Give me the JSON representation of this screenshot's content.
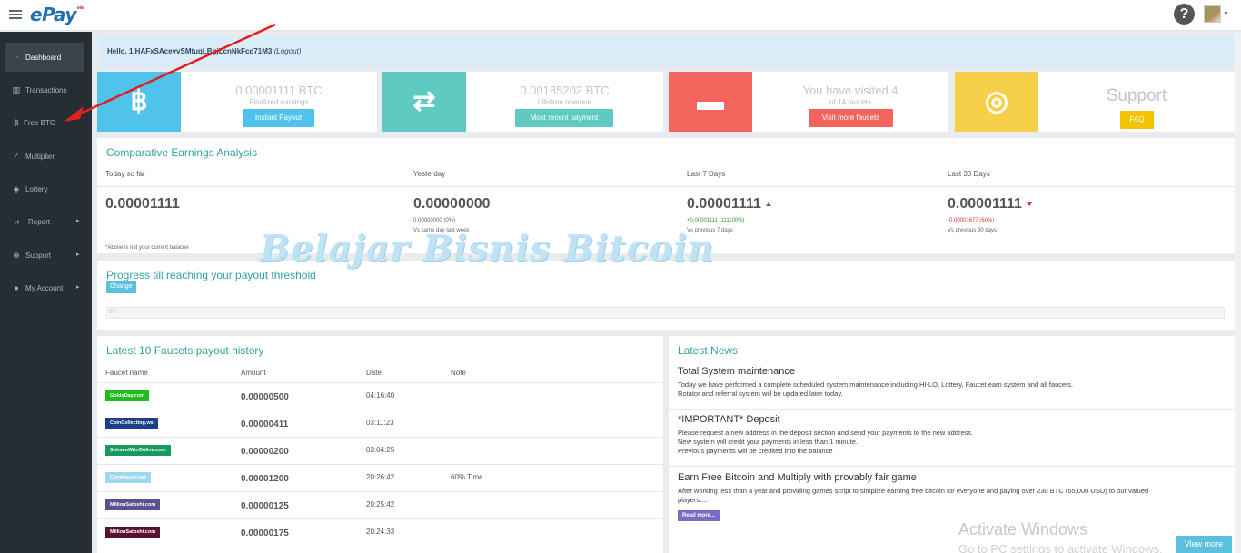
{
  "app": {
    "logo": "ePay",
    "logo_sup": "info"
  },
  "header": {
    "help_glyph": "?"
  },
  "sidebar": {
    "items": [
      {
        "label": "Dashboard",
        "icon": "dashboard-icon"
      },
      {
        "label": "Transactions",
        "icon": "bar-chart-icon"
      },
      {
        "label": "Free BTC",
        "icon": "bitcoin-icon"
      },
      {
        "label": "Multiplier",
        "icon": "magic-wand-icon"
      },
      {
        "label": "Lottery",
        "icon": "ticket-icon"
      },
      {
        "label": "Report",
        "icon": "line-chart-icon"
      },
      {
        "label": "Support",
        "icon": "lifebuoy-icon"
      },
      {
        "label": "My Account",
        "icon": "user-icon"
      }
    ]
  },
  "greeting": {
    "hello": "Hello, 1iHAFxSAcevvSMtuqLBgjLcnNkFcd71M3",
    "logout": "(Logout)"
  },
  "cards": {
    "btc": {
      "value": "0.00001111 BTC",
      "caption": "Finalized earnings",
      "button": "Instant Payout",
      "color": "#4fc3ec"
    },
    "lifetime": {
      "value": "0.00185202 BTC",
      "caption": "Lifetime revenue",
      "button": "Most recent payment",
      "color": "#5fcac2"
    },
    "visited": {
      "value": "You have visited 4",
      "caption": "of 14 faucets",
      "button": "Visit more faucets",
      "color": "#f3645c"
    },
    "support": {
      "value": "Support",
      "button": "FAQ",
      "color": "#f7d04a"
    }
  },
  "earnings": {
    "title": "Comparative Earnings Analysis",
    "columns": [
      {
        "head": "Today so far",
        "value": "0.00001111",
        "sub1": "",
        "sub2": "",
        "note": "*Above is not your current balacne"
      },
      {
        "head": "Yesterday",
        "value": "0.00000000",
        "sub1": "0.00000000 (0%)",
        "sub2": "Vs same day last week",
        "note": ""
      },
      {
        "head": "Last 7 Days",
        "value": "0.00001111",
        "sub1": "+0.00001111 (111100%)",
        "sub2": "Vs previous 7 days",
        "note": ""
      },
      {
        "head": "Last 30 Days",
        "value": "0.00001111",
        "sub1": "-0.00001677 (60%)",
        "sub2": "Vs previous 30 days",
        "note": ""
      }
    ]
  },
  "progress": {
    "title": "Progress till reaching your payout threshold",
    "change": "Change",
    "percent_text": "0%",
    "fraction": 0
  },
  "faucets": {
    "title": "Latest 10 Faucets payout history",
    "headers": [
      "Faucet name",
      "Amount",
      "Date",
      "Note"
    ],
    "rows": [
      {
        "name": "GoldsDay.com",
        "amount": "0.00000500",
        "date": "04:16:40",
        "note": "",
        "color": "#1fbb1f"
      },
      {
        "name": "CoinCollecting.ws",
        "amount": "0.00000411",
        "date": "03:11:23",
        "note": "",
        "color": "#1c3f8a"
      },
      {
        "name": "SpinandWinOnline.com",
        "amount": "0.00000200",
        "date": "03:04:25",
        "note": "",
        "color": "#159a5f"
      },
      {
        "name": "CoinFaucet.net",
        "amount": "0.00001200",
        "date": "20:26:42",
        "note": "60% Time",
        "color": "#9fd6f0"
      },
      {
        "name": "MillionSatoshi.com",
        "amount": "0.00000125",
        "date": "20:25:42",
        "note": "",
        "color": "#5e4f8f"
      },
      {
        "name": "MillionSatoshi.com",
        "amount": "0.00000175",
        "date": "20:24:33",
        "note": "",
        "color": "#5a1030"
      }
    ]
  },
  "news": {
    "title": "Latest News",
    "items": [
      {
        "title": "Total System maintenance",
        "body": [
          "Today we have performed a complete scheduled system maintenance including HI-LO, Lottery, Faucet earn system and all faucets.",
          "Rotator and referral system will be updated later today."
        ]
      },
      {
        "title": "*IMPORTANT* Deposit",
        "body": [
          "Please request a new address in the deposit section and send your payments to the new address.",
          "New system will credit your payments in less than 1 minute.",
          "Previous payments will be credited into the balance"
        ]
      },
      {
        "title": "Earn Free Bitcoin and Multiply with provably fair game",
        "body": [
          "After working less than a year and providing games script to simplize earning free bitcoin for everyone and paying over 230 BTC (55,000 USD) to our valued",
          "players...."
        ],
        "readmore": "Read more..."
      }
    ],
    "view_more": "View more"
  },
  "watermark": "Belajar Bisnis Bitcoin",
  "os_overlay": {
    "title": "Activate Windows",
    "subtitle": "Go to PC settings to activate Windows."
  }
}
